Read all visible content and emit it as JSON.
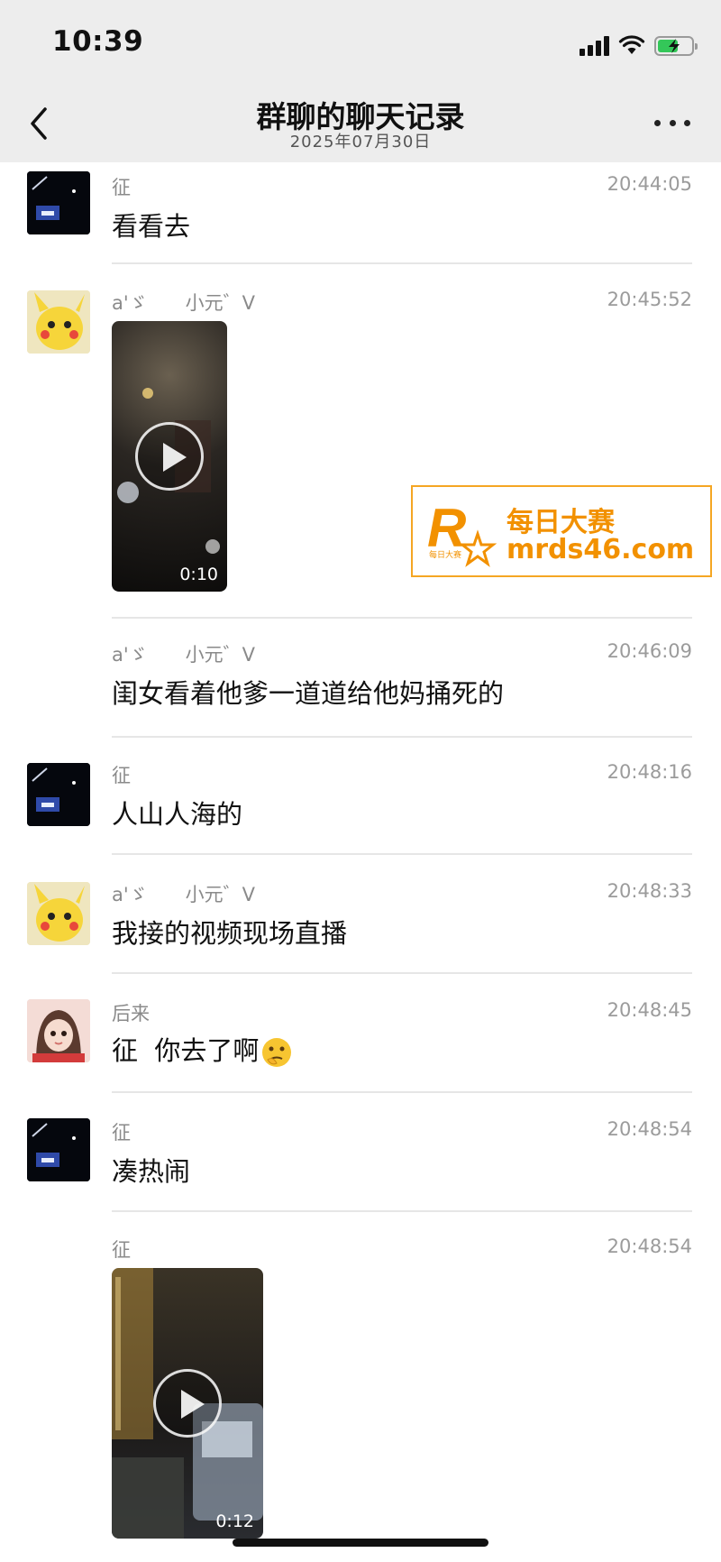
{
  "status_bar": {
    "time": "10:39"
  },
  "header": {
    "title": "群聊的聊天记录",
    "date": "2025年07月30日"
  },
  "messages": [
    {
      "sender": "征",
      "time": "20:44:05",
      "text": "看看去",
      "avatar": "night-photo-avatar"
    },
    {
      "sender": "a'ゞ　　小元゛V",
      "time": "20:45:52",
      "video_duration": "0:10",
      "avatar": "pikachu-avatar"
    },
    {
      "sender": "a'ゞ　　小元゛V",
      "time": "20:46:09",
      "text": "闺女看着他爹一道道给他妈捅死的"
    },
    {
      "sender": "征",
      "time": "20:48:16",
      "text": "人山人海的",
      "avatar": "night-photo-avatar"
    },
    {
      "sender": "a'ゞ　　小元゛V",
      "time": "20:48:33",
      "text": "我接的视频现场直播",
      "avatar": "pikachu-avatar"
    },
    {
      "sender": "后来",
      "time": "20:48:45",
      "text": "征  你去了啊",
      "emoji": "thinking-face-emoji",
      "avatar": "girl-avatar"
    },
    {
      "sender": "征",
      "time": "20:48:54",
      "text": "凑热闹",
      "avatar": "night-photo-avatar"
    },
    {
      "sender": "征",
      "time": "20:48:54",
      "video_duration": "0:12"
    }
  ],
  "watermark": {
    "title": "每日大赛",
    "url": "mrds46.com",
    "logo_letter": "R",
    "logo_small": "每日大赛"
  },
  "colors": {
    "accent": "#f29100",
    "topbar": "#ededed"
  }
}
